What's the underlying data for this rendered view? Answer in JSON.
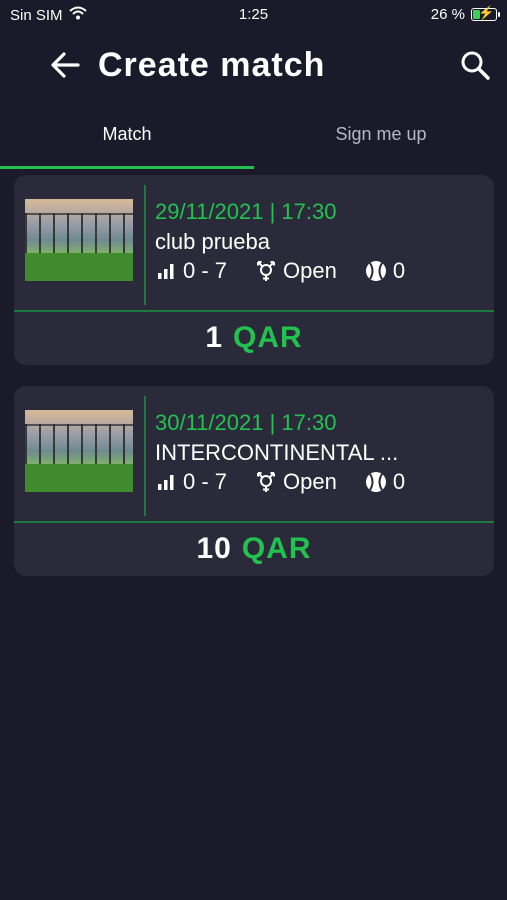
{
  "status_bar": {
    "carrier": "Sin SIM",
    "time": "1:25",
    "battery": "26 %"
  },
  "header": {
    "title": "Create match"
  },
  "tabs": [
    {
      "label": "Match",
      "active": true
    },
    {
      "label": "Sign me up",
      "active": false
    }
  ],
  "matches": [
    {
      "date": "29/11/2021 | 17:30",
      "club": "club prueba",
      "level": "0 - 7",
      "gender": "Open",
      "balls": "0",
      "price_amount": "1",
      "price_currency": "QAR"
    },
    {
      "date": "30/11/2021 | 17:30",
      "club": "INTERCONTINENTAL ...",
      "level": "0 - 7",
      "gender": "Open",
      "balls": "0",
      "price_amount": "10",
      "price_currency": "QAR"
    }
  ],
  "colors": {
    "background": "#1a1a2b",
    "card": "#2a2a3b",
    "accent": "#22c24e",
    "divider": "#1c7a3f"
  }
}
